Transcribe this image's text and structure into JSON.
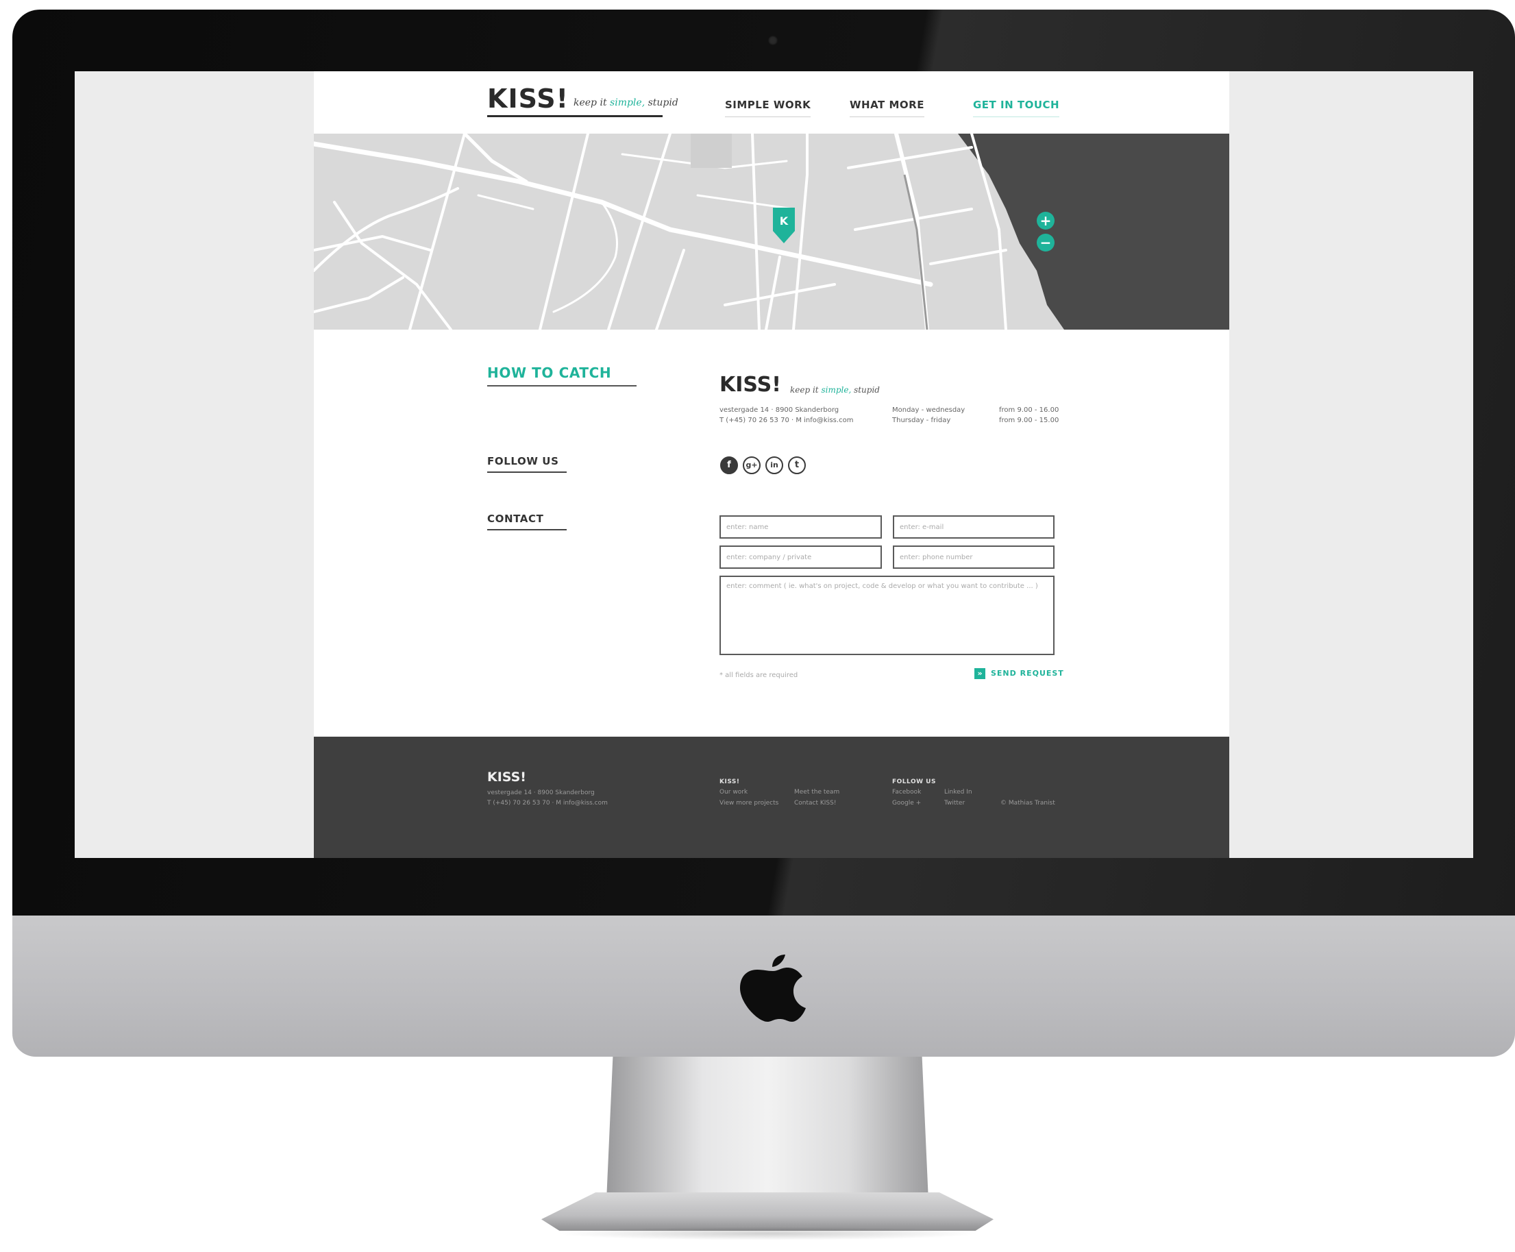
{
  "brand": {
    "logo": "KISS!",
    "tagline_pre": "keep it ",
    "tagline_accent": "simple,",
    "tagline_post": " stupid",
    "accent_color": "#1fb39a"
  },
  "nav": {
    "items": [
      {
        "label": "SIMPLE WORK"
      },
      {
        "label": "WHAT MORE"
      },
      {
        "label": "GET IN TOUCH",
        "active": true
      }
    ]
  },
  "map": {
    "marker_letter": "K",
    "zoom_in": "+",
    "zoom_out": "−"
  },
  "sections": {
    "how_to_catch": "HOW TO CATCH",
    "follow_us": "FOLLOW US",
    "contact": "CONTACT"
  },
  "info": {
    "address": "vestergade 14 · 8900 Skanderborg",
    "phone_line": "T (+45) 70 26 53 70 · M info@kiss.com",
    "days_1": "Monday - wednesday",
    "days_2": "Thursday - friday",
    "hours_1": "from 9.00 - 16.00",
    "hours_2": "from 9.00 - 15.00"
  },
  "social": [
    {
      "icon": "facebook-icon",
      "glyph": "f"
    },
    {
      "icon": "google-plus-icon",
      "glyph": "g+"
    },
    {
      "icon": "linkedin-icon",
      "glyph": "in"
    },
    {
      "icon": "twitter-icon",
      "glyph": "t"
    }
  ],
  "form": {
    "name_placeholder": "enter: name",
    "email_placeholder": "enter: e-mail",
    "company_placeholder": "enter: company / private",
    "phone_placeholder": "enter: phone number",
    "message_placeholder": "enter: comment ( ie. what's on project, code & develop or what you want to contribute ... )",
    "required_note": "* all fields are required",
    "send_label": "SEND REQUEST",
    "send_icon": "»"
  },
  "footer": {
    "logo": "KISS!",
    "address": "vestergade 14 · 8900 Skanderborg",
    "phone_line": "T (+45) 70 26 53 70 · M info@kiss.com",
    "col1_head": "KISS!",
    "col1_links": [
      "Our work",
      "Meet the team",
      "View more projects",
      "Contact KISS!"
    ],
    "col2_head": "FOLLOW US",
    "col2_links": [
      "Facebook",
      "Linked In",
      "Google +",
      "Twitter"
    ],
    "copyright": "© Mathias Tranist"
  }
}
